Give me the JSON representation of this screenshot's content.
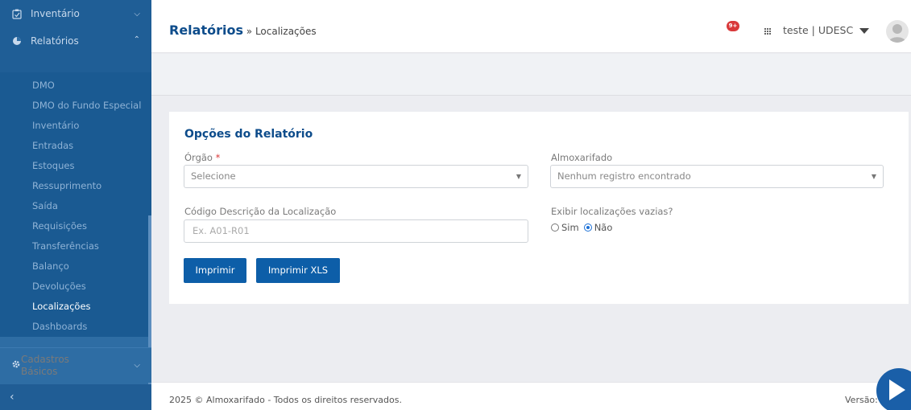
{
  "sidebar": {
    "inventario": "Inventário",
    "relatorios": "Relatórios",
    "items": [
      "DMO",
      "DMO do Fundo Especial",
      "Inventário",
      "Entradas",
      "Estoques",
      "Ressuprimento",
      "Saída",
      "Requisições",
      "Transferências",
      "Balanço",
      "Devoluções",
      "Localizações",
      "Dashboards"
    ],
    "cadastros_line1": "Cadastros",
    "cadastros_line2": "Básicos",
    "collapse": "‹"
  },
  "header": {
    "title": "Relatórios",
    "crumb": " » Localizações",
    "notif_count": "9+",
    "user": "teste | UDESC"
  },
  "form": {
    "title": "Opções do Relatório",
    "orgao_label": "Órgão",
    "orgao_required": "*",
    "orgao_value": "Selecione",
    "almox_label": "Almoxarifado",
    "almox_value": "Nenhum registro encontrado",
    "codigo_label": "Código Descrição da Localização",
    "codigo_placeholder": "Ex. A01-R01",
    "exibir_label": "Exibir localizações vazias?",
    "sim": "Sim",
    "nao": "Não",
    "selected": "Não",
    "btn_imprimir": "Imprimir",
    "btn_xls": "Imprimir XLS"
  },
  "footer": {
    "copy": "2025 © Almoxarifado - Todos os direitos reservados.",
    "versao": "Versão:"
  },
  "colors": {
    "primary": "#0d5ea8",
    "sidebar": "#2e6da4",
    "badge": "#d9393a"
  }
}
